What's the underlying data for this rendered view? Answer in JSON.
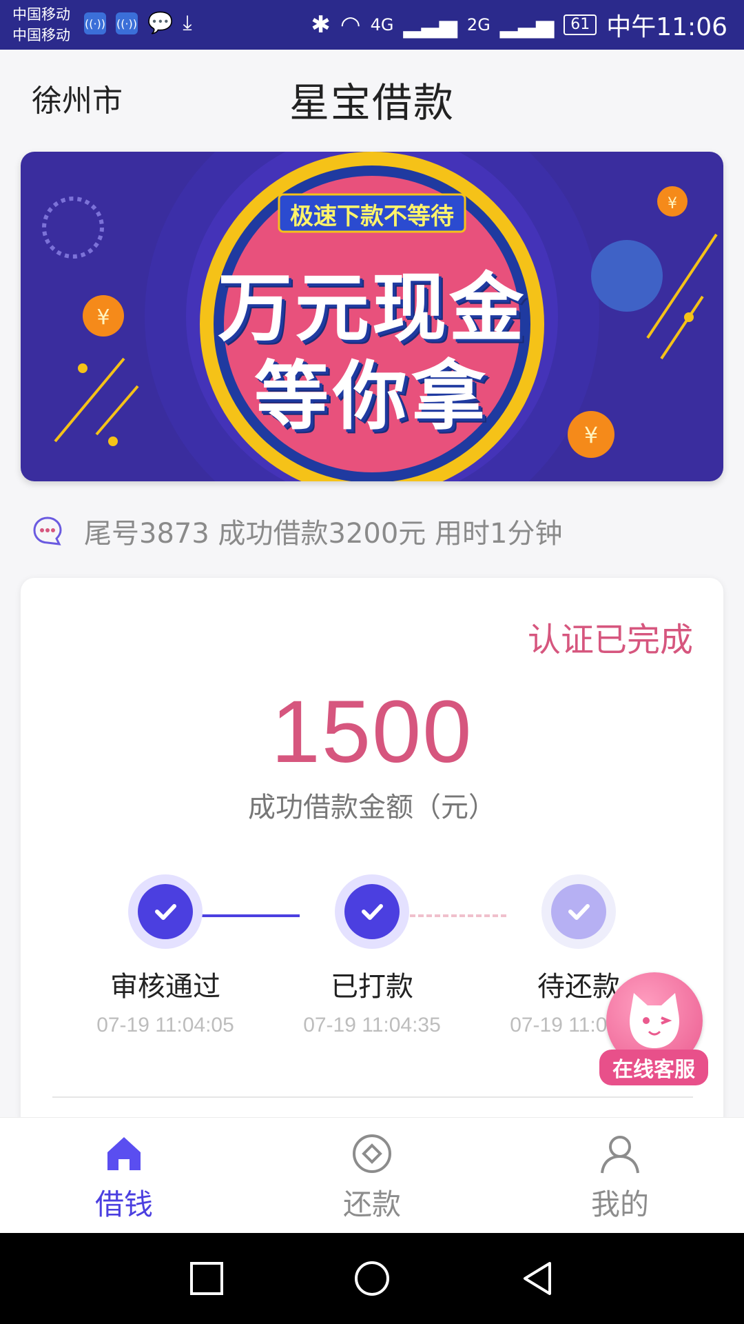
{
  "status_bar": {
    "carrier_1": "中国移动",
    "carrier_2": "中国移动",
    "network_4g": "4G",
    "network_2g": "2G",
    "battery": "61",
    "time": "中午11:06"
  },
  "header": {
    "city": "徐州市",
    "title": "星宝借款"
  },
  "banner": {
    "tagline": "极速下款不等待",
    "headline_line1": "万元现金",
    "headline_line2": "等你拿",
    "colors": {
      "background": "#3a2d9e",
      "circle": "#e8517c",
      "ring": "#f5c218"
    }
  },
  "ticker": {
    "icon": "chat-bubble-icon",
    "text": "尾号3873 成功借款3200元 用时1分钟"
  },
  "card": {
    "cert_status": "认证已完成",
    "amount": "1500",
    "amount_label": "成功借款金额（元）",
    "steps": [
      {
        "label": "审核通过",
        "time": "07-19 11:04:05",
        "done": true
      },
      {
        "label": "已打款",
        "time": "07-19 11:04:35",
        "done": true
      },
      {
        "label": "待还款",
        "time": "07-19 11:04:35",
        "done": false
      }
    ]
  },
  "float_service": {
    "label": "在线客服"
  },
  "tabs": [
    {
      "label": "借钱",
      "icon": "home-icon",
      "active": true
    },
    {
      "label": "还款",
      "icon": "coin-icon",
      "active": false
    },
    {
      "label": "我的",
      "icon": "user-icon",
      "active": false
    }
  ],
  "colors": {
    "accent": "#4b3fe0",
    "pink": "#d6567e",
    "status_bar": "#2b2a8c"
  }
}
